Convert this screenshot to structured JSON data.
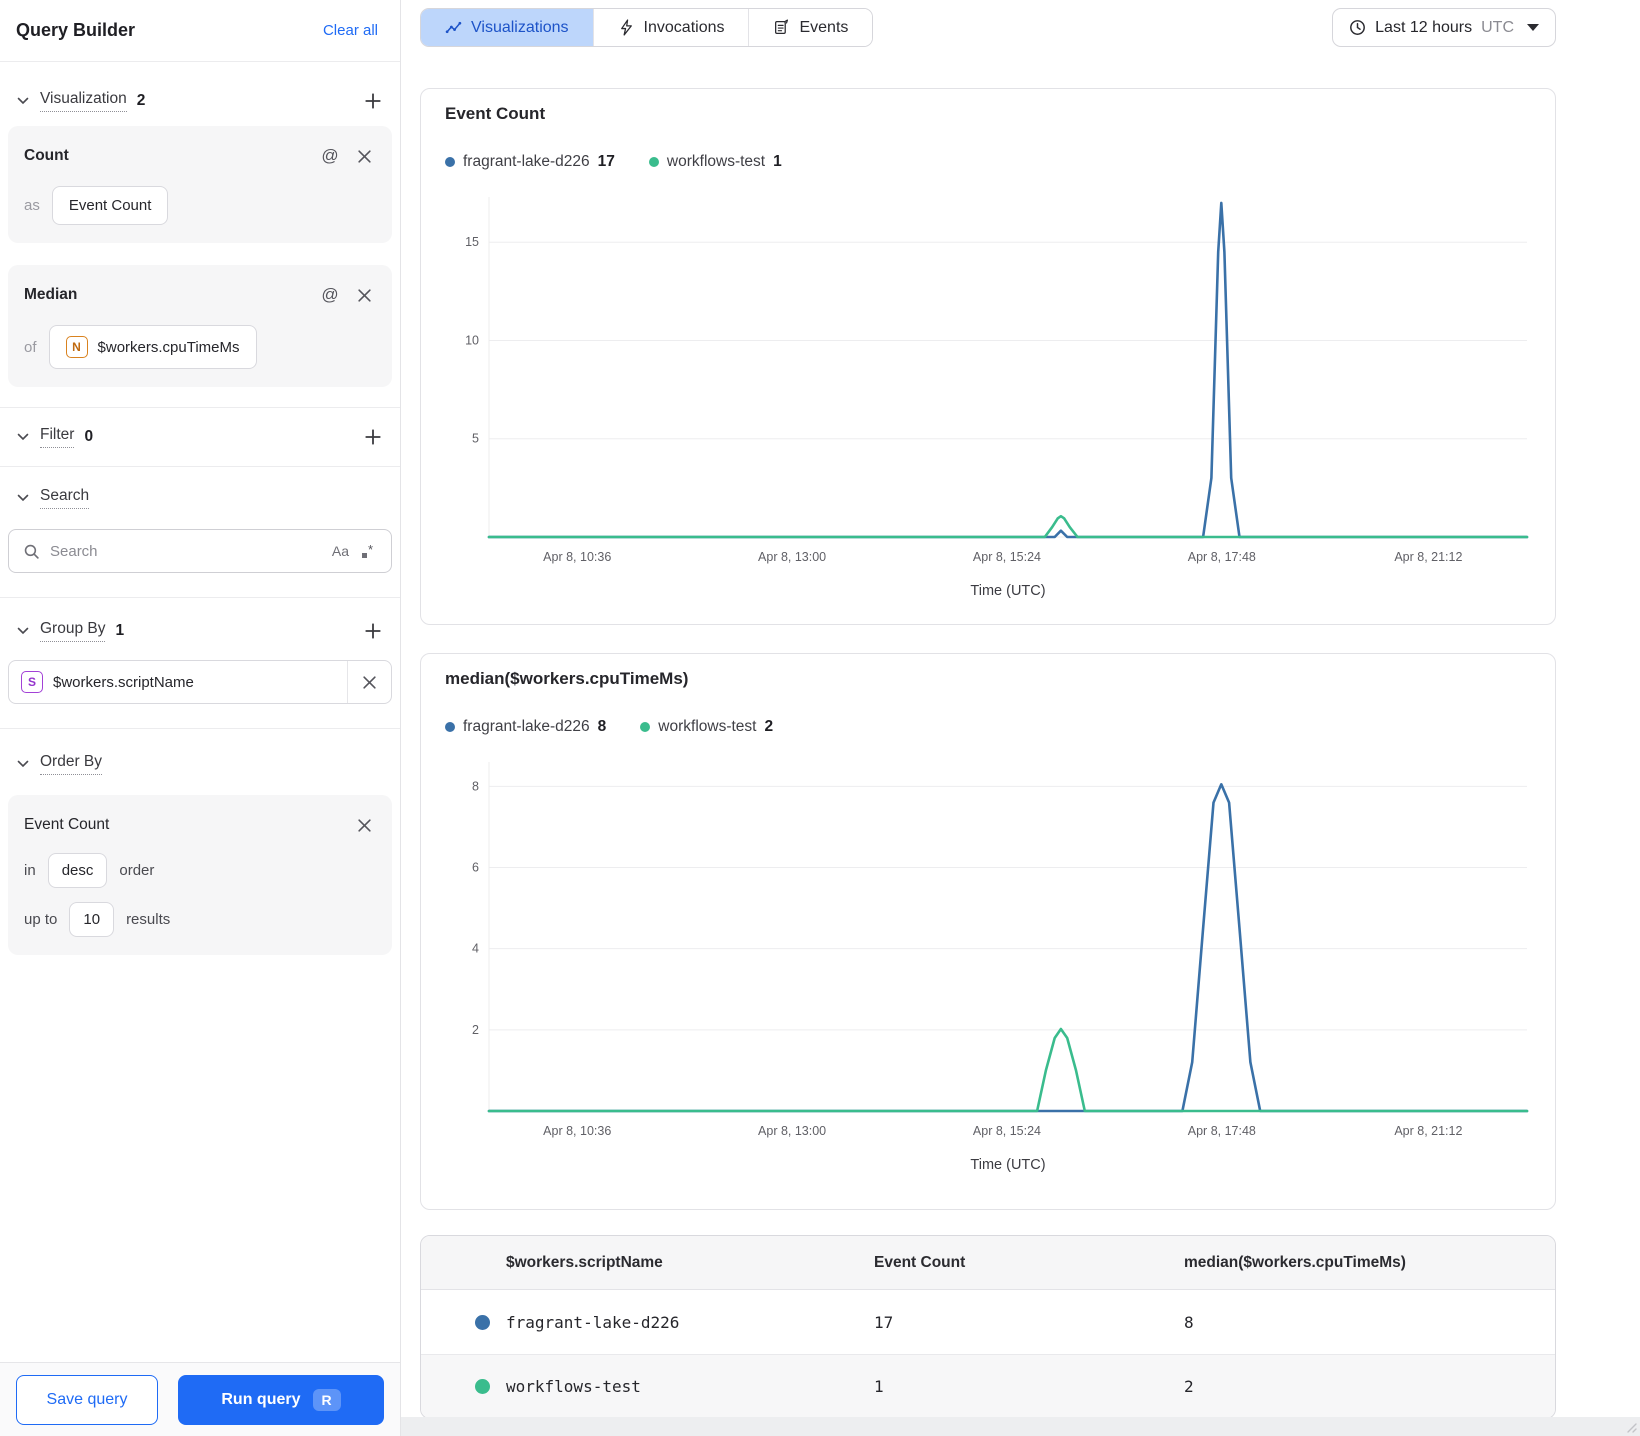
{
  "sidebar": {
    "title": "Query Builder",
    "clear_all_label": "Clear all",
    "visualization": {
      "label": "Visualization",
      "count": "2",
      "cards": [
        {
          "fn": "Count",
          "key_label": "as",
          "value": "Event Count"
        },
        {
          "fn": "Median",
          "key_label": "of",
          "field_badge": "N",
          "value": "$workers.cpuTimeMs"
        }
      ]
    },
    "filter": {
      "label": "Filter",
      "count": "0"
    },
    "search": {
      "label": "Search",
      "placeholder": "Search",
      "case_tool": "Aa",
      "regex_tool": "*"
    },
    "group_by": {
      "label": "Group By",
      "count": "1",
      "item": {
        "badge": "S",
        "field": "$workers.scriptName"
      }
    },
    "order_by": {
      "label": "Order By",
      "field": "Event Count",
      "in_label": "in",
      "direction": "desc",
      "order_label": "order",
      "up_to_label": "up to",
      "limit": "10",
      "results_label": "results"
    },
    "footer": {
      "save_label": "Save query",
      "run_label": "Run query",
      "run_shortcut": "R"
    }
  },
  "topbar": {
    "tabs": [
      {
        "label": "Visualizations",
        "active": true
      },
      {
        "label": "Invocations",
        "active": false
      },
      {
        "label": "Events",
        "active": false
      }
    ],
    "time_range": {
      "label": "Last 12 hours",
      "timezone": "UTC"
    }
  },
  "chart_data": [
    {
      "type": "line",
      "title": "Event Count",
      "xlabel": "Time (UTC)",
      "x_ticks": [
        "Apr 8, 10:36",
        "Apr 8, 13:00",
        "Apr 8, 15:24",
        "Apr 8, 17:48",
        "Apr 8, 21:12"
      ],
      "x_tick_fractions": [
        0.085,
        0.292,
        0.499,
        0.706,
        0.905
      ],
      "y_ticks": [
        5,
        10,
        15
      ],
      "ylim": [
        0,
        17.3
      ],
      "grid": true,
      "legend_position": "top",
      "series": [
        {
          "name": "fragrant-lake-d226",
          "total": "17",
          "color": "#3a71a8",
          "points": [
            [
              0,
              0
            ],
            [
              0.53,
              0
            ],
            [
              0.545,
              0
            ],
            [
              0.551,
              0.32
            ],
            [
              0.557,
              0
            ],
            [
              0.66,
              0
            ],
            [
              0.688,
              0
            ],
            [
              0.696,
              3
            ],
            [
              0.7025,
              14.5
            ],
            [
              0.7055,
              17
            ],
            [
              0.7085,
              14.5
            ],
            [
              0.715,
              3
            ],
            [
              0.723,
              0
            ],
            [
              1,
              0
            ]
          ]
        },
        {
          "name": "workflows-test",
          "total": "1",
          "color": "#3abc8d",
          "points": [
            [
              0,
              0
            ],
            [
              0.5355,
              0
            ],
            [
              0.5425,
              0.5
            ],
            [
              0.548,
              0.95
            ],
            [
              0.551,
              1.06
            ],
            [
              0.554,
              0.95
            ],
            [
              0.5595,
              0.5
            ],
            [
              0.567,
              0
            ],
            [
              1,
              0
            ]
          ]
        }
      ]
    },
    {
      "type": "line",
      "title": "median($workers.cpuTimeMs)",
      "xlabel": "Time (UTC)",
      "x_ticks": [
        "Apr 8, 10:36",
        "Apr 8, 13:00",
        "Apr 8, 15:24",
        "Apr 8, 17:48",
        "Apr 8, 21:12"
      ],
      "x_tick_fractions": [
        0.085,
        0.292,
        0.499,
        0.706,
        0.905
      ],
      "y_ticks": [
        2,
        4,
        6,
        8
      ],
      "ylim": [
        0,
        8.6
      ],
      "grid": true,
      "legend_position": "top",
      "series": [
        {
          "name": "fragrant-lake-d226",
          "total": "8",
          "color": "#3a71a8",
          "points": [
            [
              0,
              0
            ],
            [
              0.668,
              0
            ],
            [
              0.6775,
              1.2
            ],
            [
              0.688,
              4.5
            ],
            [
              0.698,
              7.6
            ],
            [
              0.7055,
              8.05
            ],
            [
              0.713,
              7.6
            ],
            [
              0.723,
              4.5
            ],
            [
              0.7335,
              1.2
            ],
            [
              0.743,
              0
            ],
            [
              1,
              0
            ]
          ]
        },
        {
          "name": "workflows-test",
          "total": "2",
          "color": "#3abc8d",
          "points": [
            [
              0,
              0
            ],
            [
              0.528,
              0
            ],
            [
              0.5365,
              1.0
            ],
            [
              0.545,
              1.8
            ],
            [
              0.551,
              2.02
            ],
            [
              0.557,
              1.8
            ],
            [
              0.5655,
              1.0
            ],
            [
              0.574,
              0
            ],
            [
              1,
              0
            ]
          ]
        }
      ]
    }
  ],
  "table": {
    "columns": [
      "$workers.scriptName",
      "Event Count",
      "median($workers.cpuTimeMs)"
    ],
    "rows": [
      {
        "color": "#3a71a8",
        "script_name": "fragrant-lake-d226",
        "event_count": "17",
        "median_cpu": "8"
      },
      {
        "color": "#3abc8d",
        "script_name": "workflows-test",
        "event_count": "1",
        "median_cpu": "2"
      }
    ]
  }
}
